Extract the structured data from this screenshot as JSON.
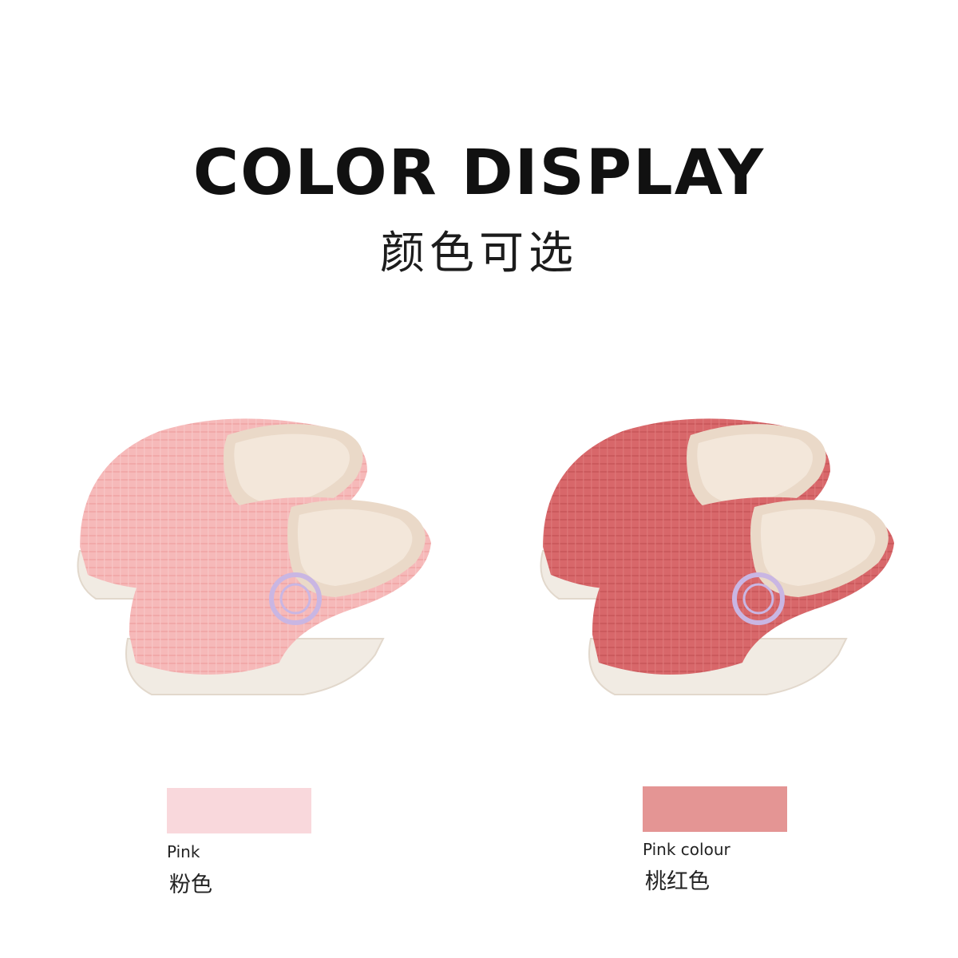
{
  "header": {
    "title": "COLOR DISPLAY",
    "subtitle": "颜色可选"
  },
  "products": [
    {
      "name_en": "Pink",
      "name_zh": "粉色",
      "swatch_color": "#f9d8dc",
      "upper_color": "#f6b9b9",
      "upper_shade": "#ee9e9f"
    },
    {
      "name_en": "Pink colour",
      "name_zh": "桃红色",
      "swatch_color": "#e49594",
      "upper_color": "#d8676a",
      "upper_shade": "#c65457"
    }
  ],
  "colors": {
    "lining": "#ead9c8",
    "sole": "#f1ebe3",
    "badge": "#c9b6e3"
  }
}
